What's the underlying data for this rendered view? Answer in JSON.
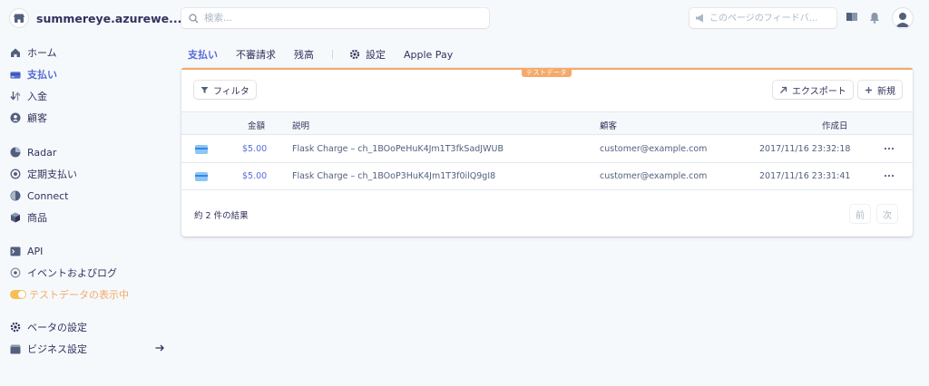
{
  "account": {
    "name": "summereye.azurewe...",
    "logo_icon": "store-icon"
  },
  "search": {
    "placeholder": "検索..."
  },
  "feedback": {
    "placeholder": "このページのフィードバ..."
  },
  "sidebar": {
    "items": [
      {
        "label": "ホーム",
        "icon": "home-icon"
      },
      {
        "label": "支払い",
        "icon": "payments-icon",
        "active": true
      },
      {
        "label": "入金",
        "icon": "payouts-icon"
      },
      {
        "label": "顧客",
        "icon": "customers-icon"
      },
      {
        "label": "Radar",
        "icon": "radar-icon"
      },
      {
        "label": "定期支払い",
        "icon": "subscriptions-icon"
      },
      {
        "label": "Connect",
        "icon": "connect-icon"
      },
      {
        "label": "商品",
        "icon": "products-icon"
      },
      {
        "label": "API",
        "icon": "terminal-icon"
      },
      {
        "label": "イベントおよびログ",
        "icon": "events-icon"
      },
      {
        "label": "テストデータの表示中",
        "icon": "toggle-icon",
        "state": "on"
      },
      {
        "label": "ベータの設定",
        "icon": "settings-icon"
      },
      {
        "label": "ビジネス設定",
        "icon": "business-icon"
      }
    ]
  },
  "tabs": [
    {
      "label": "支払い",
      "active": true
    },
    {
      "label": "不審請求"
    },
    {
      "label": "残高"
    },
    {
      "label": "設定",
      "icon": "gear-icon"
    },
    {
      "label": "Apple Pay"
    }
  ],
  "panel": {
    "badge": "テストデータ",
    "filter_label": "フィルタ",
    "export_label": "エクスポート",
    "new_label": "新規",
    "columns": {
      "amount": "金額",
      "description": "説明",
      "customer": "顧客",
      "created": "作成日"
    },
    "rows": [
      {
        "amount": "$5.00",
        "description": "Flask Charge – ch_1BOoPeHuK4Jm1T3fkSadJWUB",
        "customer": "customer@example.com",
        "created": "2017/11/16 23:32:18"
      },
      {
        "amount": "$5.00",
        "description": "Flask Charge – ch_1BOoP3HuK4Jm1T3f0ilQ9gI8",
        "customer": "customer@example.com",
        "created": "2017/11/16 23:31:41"
      }
    ],
    "result_count": "約 2 件の結果",
    "prev_label": "前",
    "next_label": "次"
  },
  "colors": {
    "accent": "#556cd6",
    "test_mode": "#f5a96a",
    "toggle": "#f5be58",
    "background": "#f6f9fc"
  }
}
